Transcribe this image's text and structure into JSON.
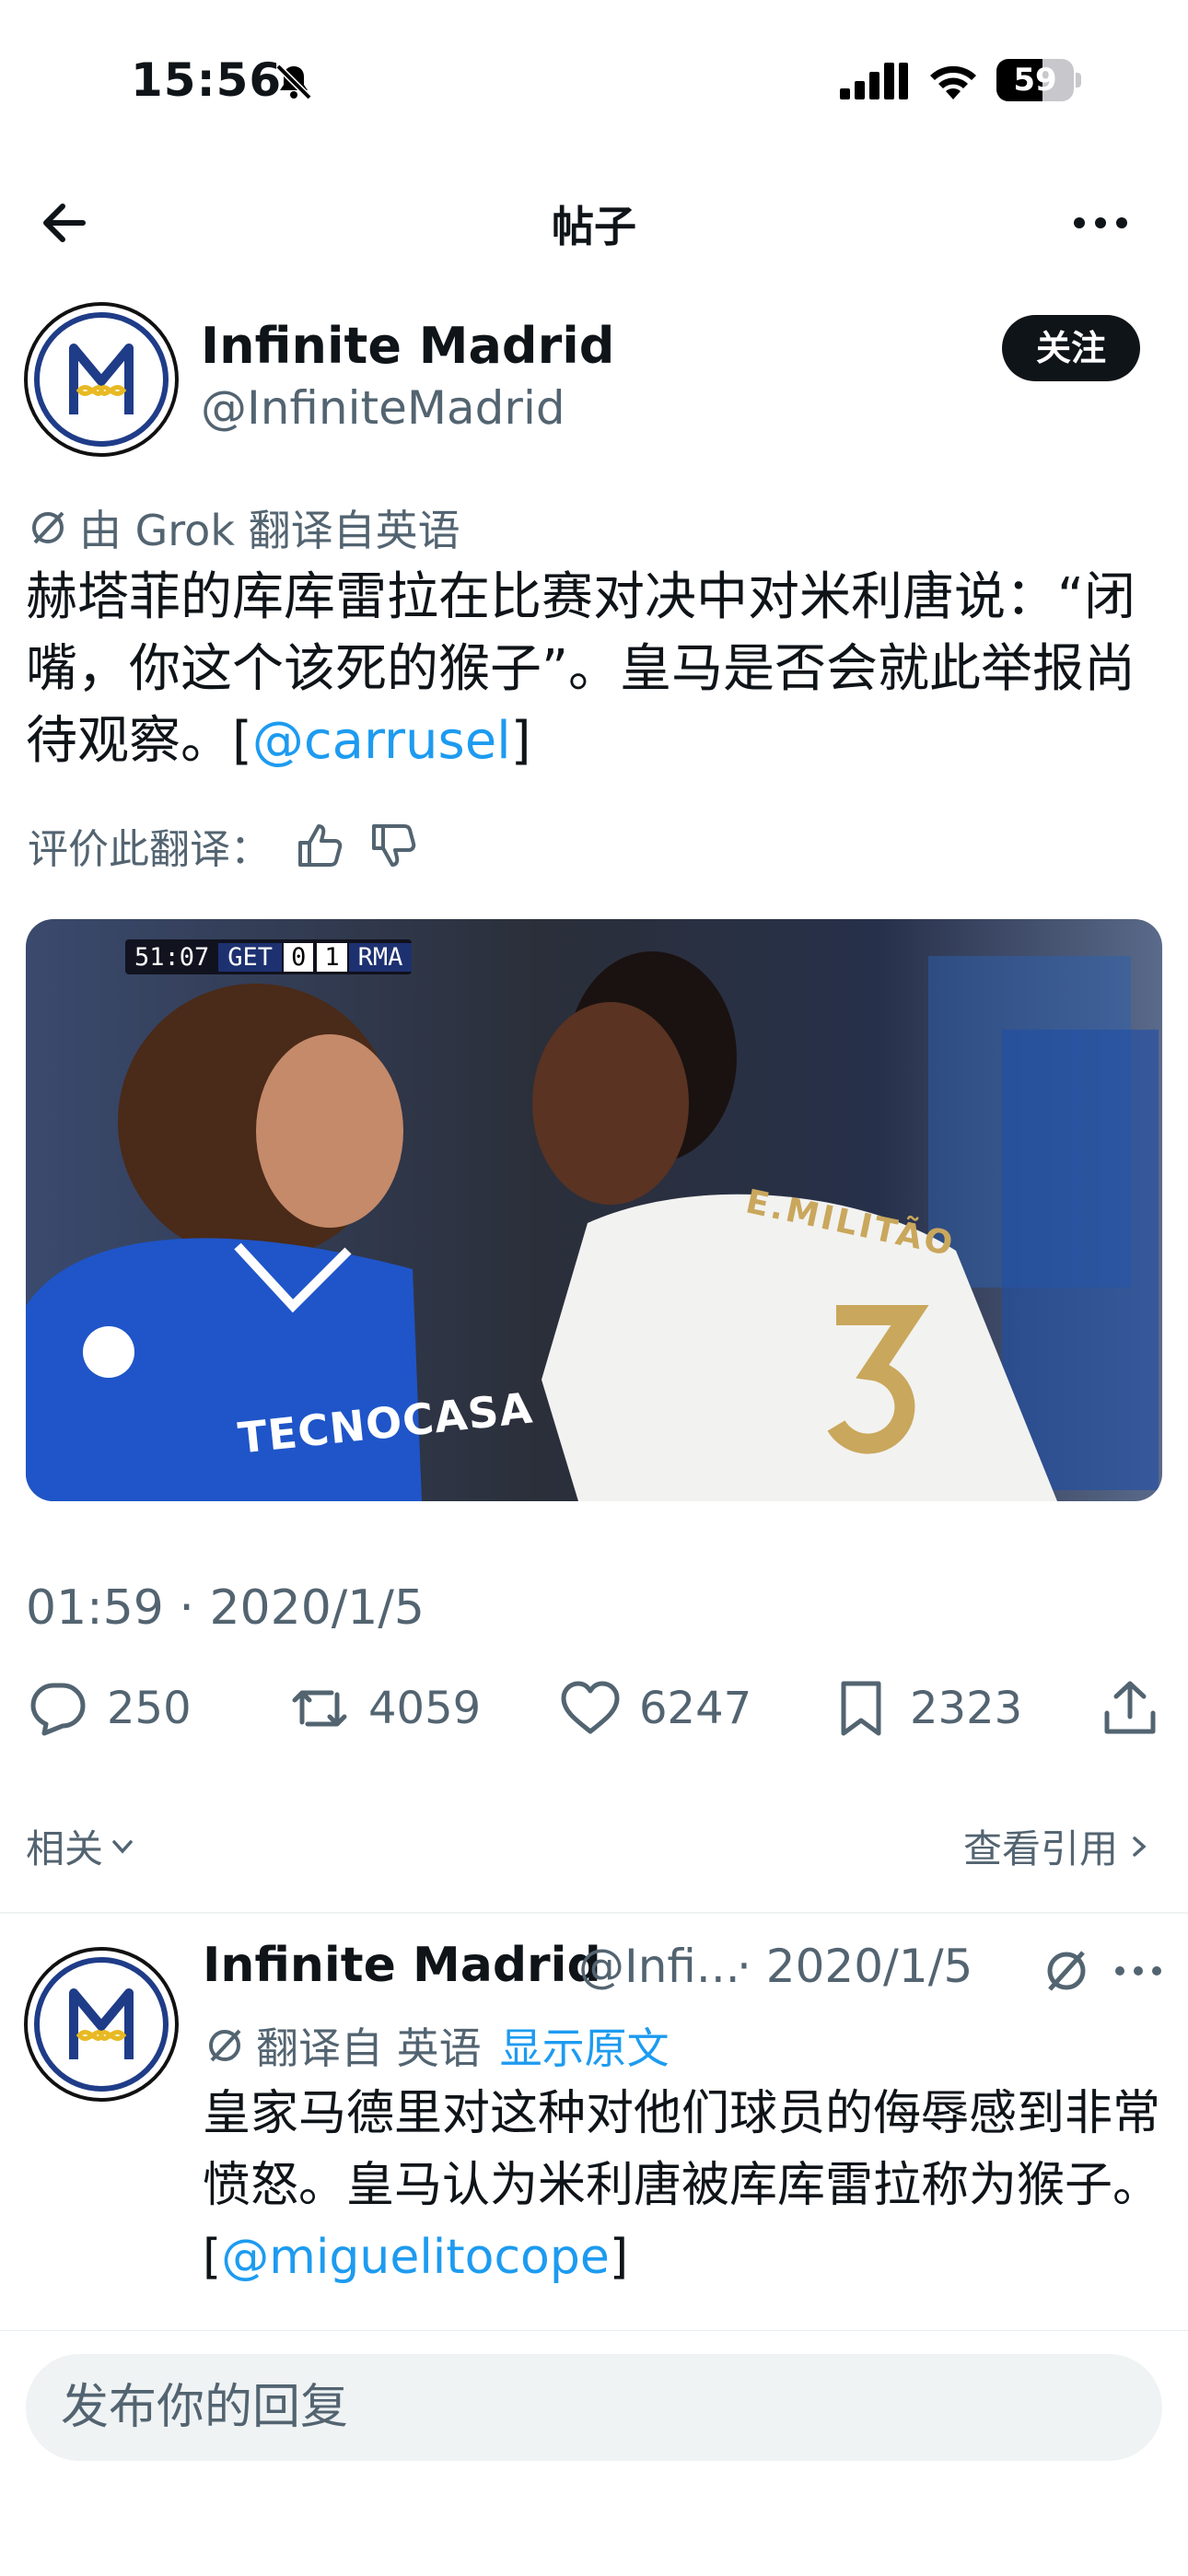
{
  "status_bar": {
    "time": "15:56",
    "battery": "59",
    "battery_level": 0.59
  },
  "nav": {
    "title": "帖子"
  },
  "post": {
    "author_name": "Infinite Madrid",
    "author_handle": "@InfiniteMadrid",
    "follow_label": "关注",
    "translation_note": "由 Grok 翻译自英语",
    "text": "赫塔菲的库库雷拉在比赛对决中对米利唐说：“闭嘴，你这个该死的猴子”。皇马是否会就此举报尚待观察。[",
    "mention": "@carrusel",
    "text_end": "]",
    "rate_translation": "评价此翻译：",
    "media": {
      "scorebug_time": "51:07",
      "home_team": "GET",
      "home_score": "0",
      "away_score": "1",
      "away_team": "RMA",
      "shirt_name": "E.MILITÃO",
      "shirt_number": "3",
      "sponsor": "TECNOCASA"
    },
    "timestamp": "01:59 · 2020/1/5",
    "stats": {
      "replies": "250",
      "reposts": "4059",
      "likes": "6247",
      "bookmarks": "2323"
    }
  },
  "related": {
    "label": "相关",
    "view_quotes": "查看引用"
  },
  "reply": {
    "author_name": "Infinite Madrid",
    "author_handle": "@Infi...",
    "date": "· 2020/1/5",
    "translation_note": "翻译自 英语",
    "show_original": "显示原文",
    "text": "皇家马德里对这种对他们球员的侮辱感到非常愤怒。皇马认为米利唐被库库雷拉称为猴子。[",
    "mention": "@miguelitocope",
    "text_end": "]"
  },
  "compose": {
    "placeholder": "发布你的回复"
  },
  "colors": {
    "accent": "#1d9bf0",
    "secondary_text": "#536471",
    "primary_text": "#0f1419"
  }
}
